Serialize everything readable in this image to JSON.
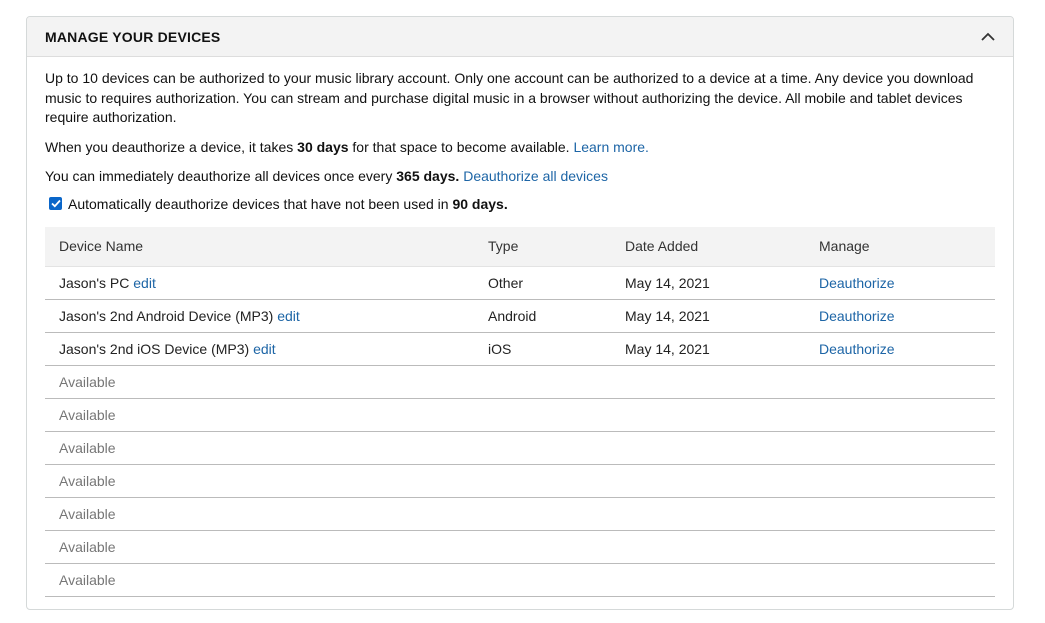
{
  "panel": {
    "title": "MANAGE YOUR DEVICES",
    "collapse_icon": "chevron-up-icon"
  },
  "intro": {
    "paragraph1": "Up to 10 devices can be authorized to your music library account. Only one account can be authorized to a device at a time. Any device you download music to requires authorization. You can stream and purchase digital music in a browser without authorizing the device. All mobile and tablet devices require authorization.",
    "paragraph2_pre": "When you deauthorize a device, it takes ",
    "paragraph2_bold": "30 days",
    "paragraph2_post": " for that space to become available. ",
    "learn_more": "Learn more.",
    "paragraph3_pre": "You can immediately deauthorize all devices once every ",
    "paragraph3_bold": "365 days.",
    "deauthorize_all": "Deauthorize all devices"
  },
  "auto_deauth": {
    "checked": true,
    "label_pre": "Automatically deauthorize devices that have not been used in ",
    "label_bold": "90 days."
  },
  "table": {
    "headers": [
      "Device Name",
      "Type",
      "Date Added",
      "Manage"
    ],
    "devices": [
      {
        "name": "Jason's PC",
        "edit": "edit",
        "type": "Other",
        "date": "May 14, 2021",
        "manage": "Deauthorize"
      },
      {
        "name": "Jason's 2nd Android Device (MP3)",
        "edit": "edit",
        "type": "Android",
        "date": "May 14, 2021",
        "manage": "Deauthorize"
      },
      {
        "name": "Jason's 2nd iOS Device (MP3)",
        "edit": "edit",
        "type": "iOS",
        "date": "May 14, 2021",
        "manage": "Deauthorize"
      }
    ],
    "available": [
      "Available",
      "Available",
      "Available",
      "Available",
      "Available",
      "Available",
      "Available"
    ]
  },
  "colors": {
    "link": "#1d65a6",
    "checkbox": "#0a66c9",
    "header_bg": "#f3f3f3"
  }
}
